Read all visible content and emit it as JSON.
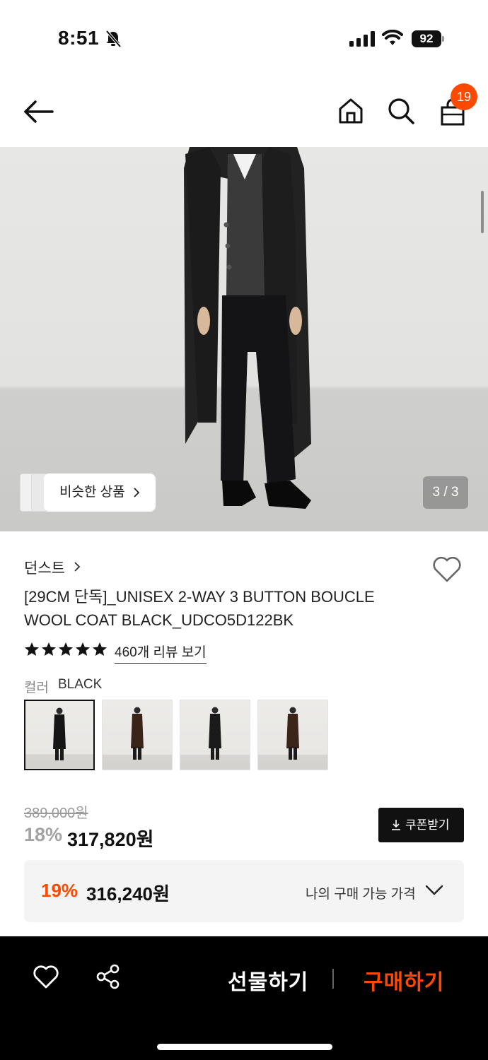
{
  "status": {
    "time": "8:51",
    "battery": "92"
  },
  "header": {
    "cart_count": "19"
  },
  "hero": {
    "similar_label": "비슷한 상품",
    "page_indicator": "3 / 3"
  },
  "product": {
    "brand": "던스트",
    "title": "[29CM 단독]_UNISEX 2-WAY 3 BUTTON BOUCLE WOOL COAT BLACK_UDCO5D122BK",
    "rating_stars": 5,
    "review_link": "460개 리뷰 보기",
    "color_label": "컬러",
    "color_value": "BLACK",
    "swatches": [
      {
        "name": "black",
        "coat": "#151515"
      },
      {
        "name": "brown",
        "coat": "#3a2418"
      },
      {
        "name": "black",
        "coat": "#1a1a1a"
      },
      {
        "name": "brown",
        "coat": "#3b2519"
      }
    ]
  },
  "price": {
    "original": "389,000원",
    "discount_rate": "18%",
    "sale_price": "317,820원",
    "coupon_label": "쿠폰받기",
    "my_rate": "19%",
    "my_price": "316,240원",
    "my_price_label": "나의 구매 가능 가격"
  },
  "bottom_bar": {
    "gift_label": "선물하기",
    "buy_label": "구매하기"
  },
  "colors": {
    "accent": "#ff4800",
    "dark": "#111111"
  }
}
